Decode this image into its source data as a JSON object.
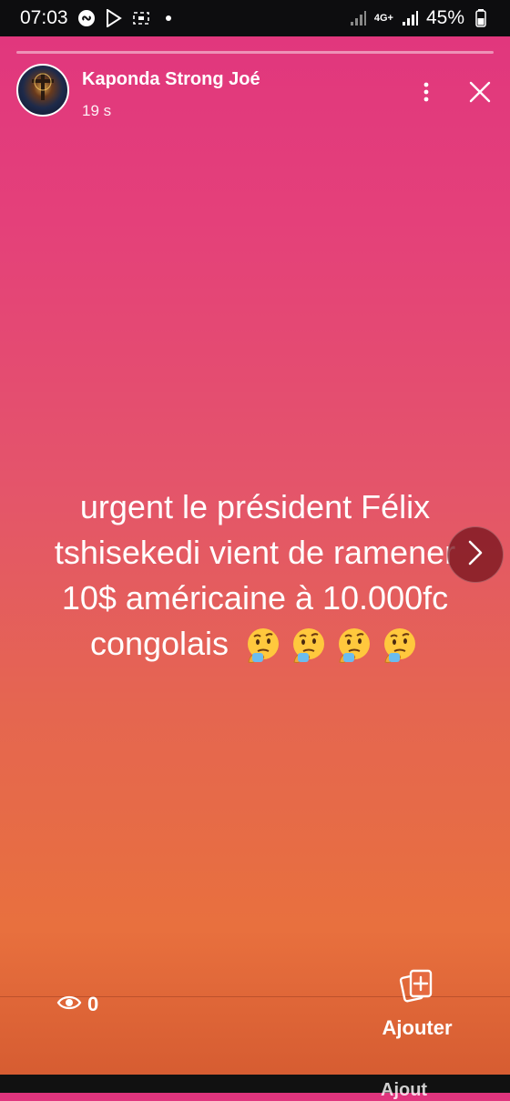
{
  "status_bar": {
    "time": "07:03",
    "network": "4G+",
    "battery": "45%",
    "icons": [
      "shazam-icon",
      "play-store-icon",
      "screen-record-icon",
      "dot-icon",
      "signal-icon",
      "network-icon",
      "signal-icon",
      "battery-icon"
    ]
  },
  "story": {
    "progress": 0.0,
    "author": "Kaponda Strong Joé",
    "time_ago": "19 s",
    "text": "urgent le président Félix tshisekedi vient de ramener 10$ américaine à 10.000fc congolais",
    "emoji_count": 4,
    "emoji_name": "thinking-face-emoji"
  },
  "footer": {
    "views": "0",
    "add_label": "Ajouter",
    "bottom_peek": "Ajout"
  },
  "colors": {
    "gradient_top": "#e0357e",
    "gradient_bottom": "#d45a30",
    "next_button": "#78141e"
  }
}
